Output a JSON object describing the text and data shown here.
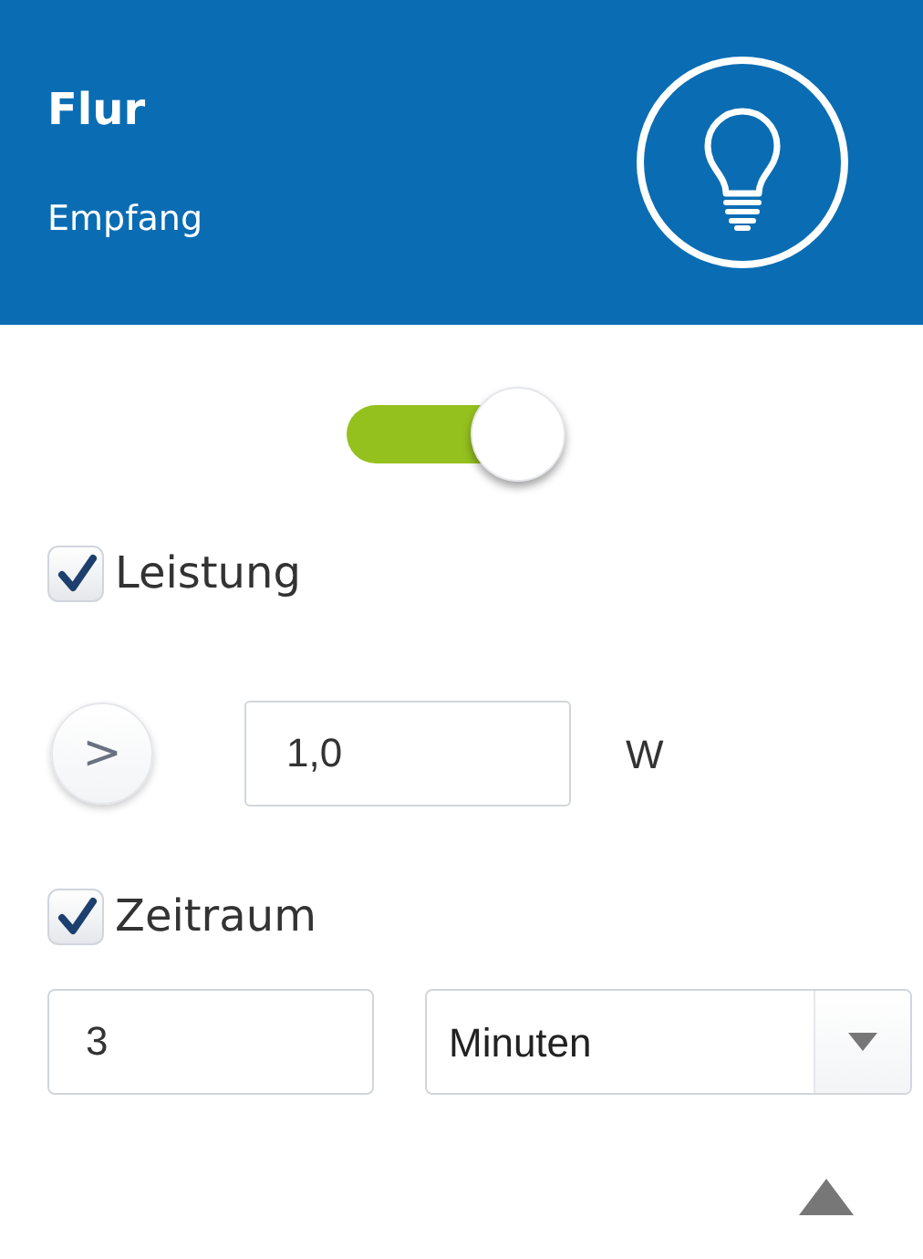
{
  "header": {
    "title": "Flur",
    "subtitle": "Empfang"
  },
  "toggle": {
    "on": true
  },
  "power": {
    "label": "Leistung",
    "checked": true,
    "operator": ">",
    "value": "1,0",
    "unit": "W"
  },
  "period": {
    "label": "Zeitraum",
    "checked": true,
    "value": "3",
    "unit": "Minuten"
  }
}
